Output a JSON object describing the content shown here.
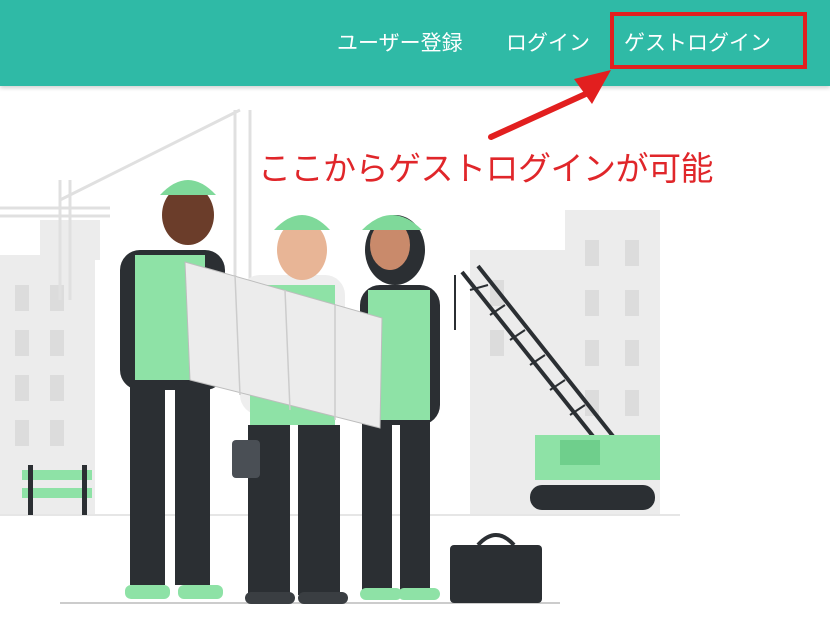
{
  "nav": {
    "register_label": "ユーザー登録",
    "login_label": "ログイン",
    "guest_login_label": "ゲストログイン"
  },
  "annotation": {
    "text": "ここからゲストログインが可能"
  },
  "colors": {
    "navbar": "#2fbaa6",
    "highlight": "#e21f1f",
    "vest": "#8ee2a6",
    "helmet": "#7fd99a",
    "dark": "#2b2f33"
  },
  "illustration": {
    "subject": "construction-workers-reading-blueprint-icon"
  }
}
